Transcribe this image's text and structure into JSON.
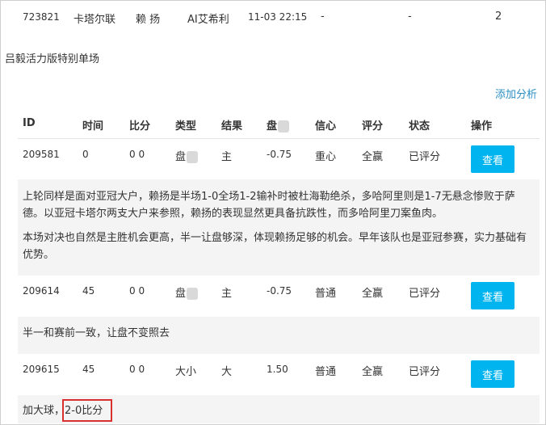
{
  "top_row": {
    "id": "723821",
    "league": "卡塔尔联",
    "team": "赖 扬",
    "opponent": "AI艾希利",
    "datetime": "11-03 22:15",
    "col5": "-",
    "col6": "-",
    "count": "2"
  },
  "section_title": "吕毅活力版特别单场",
  "add_analysis": "添加分析",
  "headers": {
    "id": "ID",
    "time": "时间",
    "score": "比分",
    "type": "类型",
    "result": "结果",
    "handicap": "盘",
    "confidence": "信心",
    "rating": "评分",
    "status": "状态",
    "action": "操作"
  },
  "rows": [
    {
      "id": "209581",
      "time": "0",
      "score": "0 0",
      "type": "盘",
      "result": "主",
      "handicap": "-0.75",
      "confidence": "重心",
      "rating": "全赢",
      "status": "已评分",
      "action": "查看",
      "analysis": [
        "上轮同样是面对亚冠大户，赖扬是半场1-0全场1-2输补时被杜海勒绝杀，多哈阿里则是1-7无悬念惨败于萨德。以亚冠卡塔尔两支大户来参照，赖扬的表现显然更具备抗跌性，而多哈阿里刀案鱼肉。",
        "本场对决也自然是主胜机会更高，半一让盘够深，体现赖扬足够的机会。早年该队也是亚冠参赛，实力基础有优势。"
      ]
    },
    {
      "id": "209614",
      "time": "45",
      "score": "0 0",
      "type": "盘",
      "result": "主",
      "handicap": "-0.75",
      "confidence": "普通",
      "rating": "全赢",
      "status": "已评分",
      "action": "查看",
      "analysis": [
        "半一和赛前一致，让盘不变照去"
      ]
    },
    {
      "id": "209615",
      "time": "45",
      "score": "0 0",
      "type": "大小",
      "result": "大",
      "handicap": "1.50",
      "confidence": "普通",
      "rating": "全赢",
      "status": "已评分",
      "action": "查看",
      "analysis_prefix": "加大球，",
      "analysis_highlight": "2-0比分"
    }
  ],
  "colors": {
    "button": "#00b4f0",
    "link": "#2a8fc4",
    "highlight_border": "#d93030",
    "row_band": "#f4f4f4"
  }
}
